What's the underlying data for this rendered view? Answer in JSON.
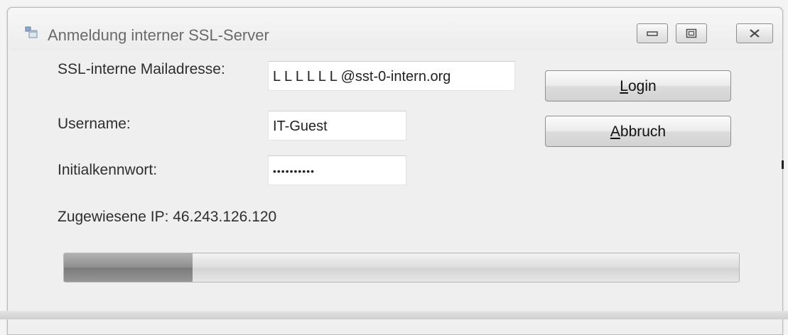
{
  "window": {
    "title": "Anmeldung interner SSL-Server",
    "icon": "app-window-icon"
  },
  "window_buttons": {
    "minimize": "minimize-icon",
    "maximize": "maximize-icon",
    "close": "close-icon"
  },
  "form": {
    "mail_label": "SSL-interne Mailadresse:",
    "mail_value": "L L L L L L @sst-0-intern.org",
    "username_label": "Username:",
    "username_value": "IT-Guest",
    "password_label": "Initialkennwort:",
    "password_value": "••••••••••",
    "ip_text": "Zugewiesene IP: 46.243.126.120"
  },
  "buttons": {
    "login_mnemonic": "L",
    "login_rest": "ogin",
    "cancel_mnemonic": "A",
    "cancel_rest": "bbruch"
  },
  "progress": {
    "fraction": 0.19
  }
}
